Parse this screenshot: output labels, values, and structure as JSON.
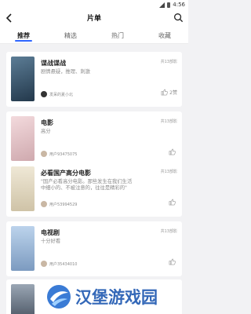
{
  "status": {
    "time": "4:56"
  },
  "header": {
    "title": "片单"
  },
  "tabs": [
    {
      "label": "推荐",
      "active": true
    },
    {
      "label": "精选",
      "active": false
    },
    {
      "label": "热门",
      "active": false
    },
    {
      "label": "收藏",
      "active": false
    }
  ],
  "cards": [
    {
      "name": "谍战谍战",
      "count": "共13部影",
      "desc": "剧情悬疑，推理、刺激",
      "user": "发呆的夏小北",
      "likes": "2赞",
      "cover_color": "#37536b"
    },
    {
      "name": "电影",
      "count": "共13部影",
      "desc": "高分",
      "user": "用户93475075",
      "likes": "",
      "cover_color": "#e6c6c8"
    },
    {
      "name": "必看国产高分电影",
      "count": "共13部影",
      "desc": "\"国产必看高分电影。那些发生在我们生活中细小的、不被注意的，往往是精彩的\"",
      "user": "用户53994529",
      "likes": "",
      "cover_color": "#e8e0cc"
    },
    {
      "name": "电视剧",
      "count": "共13部影",
      "desc": "十分好看",
      "user": "用户35434010",
      "likes": "",
      "cover_color": "#a9c4e0"
    }
  ],
  "watermark": {
    "text": "汉堡游戏园"
  },
  "colors": {
    "accent": "#2e66ff",
    "watermark": "#3468b8"
  }
}
